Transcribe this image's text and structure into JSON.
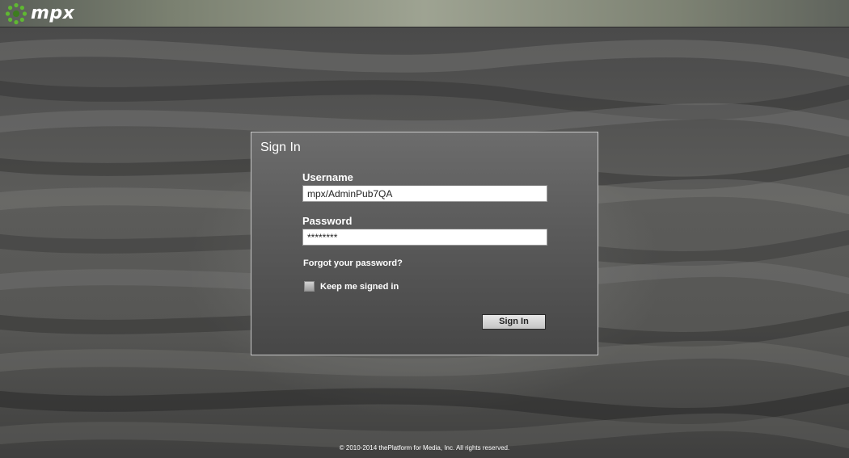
{
  "header": {
    "logo_text": "mpx",
    "logo_icon": "mpx-ring-logo",
    "brand_color": "#5fb832"
  },
  "signin": {
    "title": "Sign In",
    "username_label": "Username",
    "username_value": "mpx/AdminPub7QA",
    "password_label": "Password",
    "password_value": "********",
    "forgot_link": "Forgot your password?",
    "keep_signed_in_label": "Keep me signed in",
    "keep_signed_in_checked": false,
    "submit_label": "Sign In"
  },
  "footer": {
    "copyright": "© 2010-2014 thePlatform for Media, Inc. All rights reserved."
  }
}
